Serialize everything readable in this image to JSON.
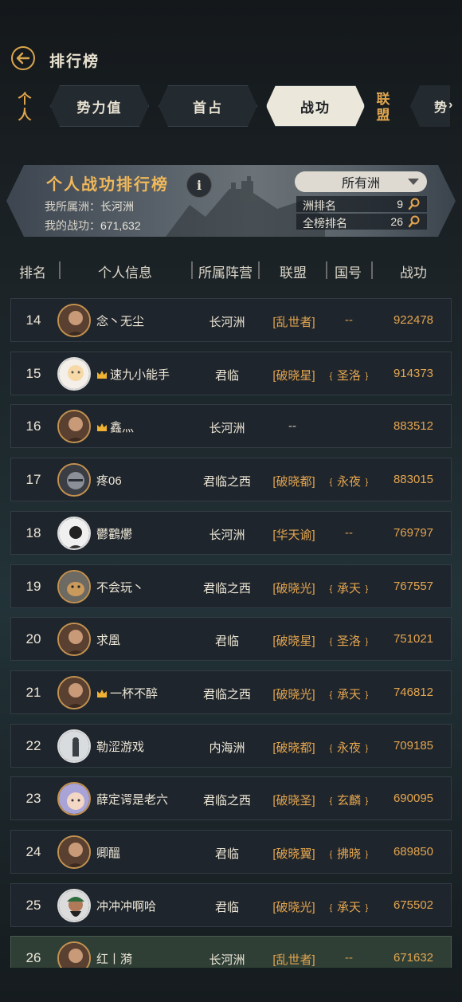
{
  "header": {
    "title": "排行榜"
  },
  "tabs": {
    "left_side": "个人",
    "items": [
      "势力值",
      "首占",
      "战功"
    ],
    "active": "战功",
    "right_side": "联盟",
    "cut_off": "势"
  },
  "banner": {
    "title": "个人战功排行榜",
    "region_label": "我所属洲：",
    "region_value": "长河洲",
    "power_label": "我的战功：",
    "power_value": "671,632",
    "filter": "所有洲",
    "region_rank_label": "洲排名",
    "region_rank": "9",
    "global_rank_label": "全榜排名",
    "global_rank": "26"
  },
  "columns": [
    "排名",
    "个人信息",
    "所属阵营",
    "联盟",
    "国号",
    "战功"
  ],
  "colors": {
    "accent": "#e3a54f",
    "highlight_row": "#2f3f36"
  },
  "rows": [
    {
      "rank": "14",
      "name": "念丶无尘",
      "crown": false,
      "camp": "长河洲",
      "alliance": "[乱世者]",
      "nation": "--",
      "power": "922478",
      "avatar": "portrait-gold"
    },
    {
      "rank": "15",
      "name": "速九小能手",
      "crown": true,
      "camp": "君临",
      "alliance": "[破晓星]",
      "nation": "﹛圣洛﹜",
      "power": "914373",
      "avatar": "cartoon-white"
    },
    {
      "rank": "16",
      "name": "鑫灬",
      "crown": true,
      "camp": "长河洲",
      "alliance": "--",
      "nation": "",
      "power": "883512",
      "avatar": "portrait-gold"
    },
    {
      "rank": "17",
      "name": "疼06",
      "crown": false,
      "camp": "君临之西",
      "alliance": "[破晓都]",
      "nation": "﹛永夜﹜",
      "power": "883015",
      "avatar": "helmet"
    },
    {
      "rank": "18",
      "name": "鬱鸖爩",
      "crown": false,
      "camp": "长河洲",
      "alliance": "[华天谕]",
      "nation": "--",
      "power": "769797",
      "avatar": "sketch"
    },
    {
      "rank": "19",
      "name": "不会玩丶",
      "crown": false,
      "camp": "君临之西",
      "alliance": "[破晓光]",
      "nation": "﹛承天﹜",
      "power": "767557",
      "avatar": "dog"
    },
    {
      "rank": "20",
      "name": "求凰",
      "crown": false,
      "camp": "君临",
      "alliance": "[破晓星]",
      "nation": "﹛圣洛﹜",
      "power": "751021",
      "avatar": "portrait-gold"
    },
    {
      "rank": "21",
      "name": "一杯不醉",
      "crown": true,
      "camp": "君临之西",
      "alliance": "[破晓光]",
      "nation": "﹛承天﹜",
      "power": "746812",
      "avatar": "portrait-gold"
    },
    {
      "rank": "22",
      "name": "勒涩游戏",
      "crown": false,
      "camp": "内海洲",
      "alliance": "[破晓都]",
      "nation": "﹛永夜﹜",
      "power": "709185",
      "avatar": "photo"
    },
    {
      "rank": "23",
      "name": "薛定谔是老六",
      "crown": false,
      "camp": "君临之西",
      "alliance": "[破晓圣]",
      "nation": "﹛玄麟﹜",
      "power": "690095",
      "avatar": "cartoon-pink"
    },
    {
      "rank": "24",
      "name": "卿醞",
      "crown": false,
      "camp": "君临",
      "alliance": "[破晓翼]",
      "nation": "﹛拂晓﹜",
      "power": "689850",
      "avatar": "portrait-gold"
    },
    {
      "rank": "25",
      "name": "冲冲冲啊哈",
      "crown": false,
      "camp": "君临",
      "alliance": "[破晓光]",
      "nation": "﹛承天﹜",
      "power": "675502",
      "avatar": "warrior"
    },
    {
      "rank": "26",
      "name": "红丨漪",
      "crown": false,
      "camp": "长河洲",
      "alliance": "[乱世者]",
      "nation": "--",
      "power": "671632",
      "avatar": "portrait-gold",
      "me": true
    }
  ]
}
